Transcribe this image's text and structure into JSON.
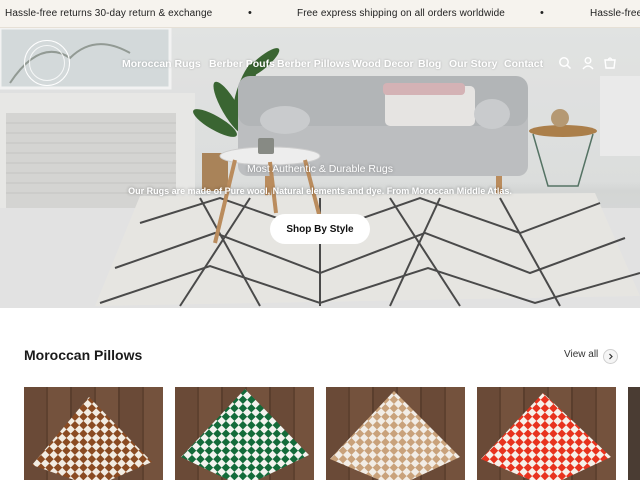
{
  "announcement": {
    "left_text": "Hassle-free returns 30-day return & exchange",
    "center_text": "Free express shipping on all orders worldwide",
    "right_text": "Hassle-free",
    "separator": "•"
  },
  "nav": {
    "items": [
      {
        "label": "Moroccan Rugs"
      },
      {
        "label": "Berber Poufs"
      },
      {
        "label": "Berber Pillows"
      },
      {
        "label": "Wood Decor"
      },
      {
        "label": "Blog"
      },
      {
        "label": "Our Story"
      },
      {
        "label": "Contact"
      }
    ],
    "icons": [
      "search-icon",
      "account-icon",
      "cart-icon"
    ]
  },
  "hero": {
    "subtitle": "Most Authentic & Durable Rugs",
    "description": "Our Rugs are made of Pure wool, Natural elements and dye. From Moroccan Middle Atlas.",
    "cta_label": "Shop By Style"
  },
  "section": {
    "title": "Moroccan Pillows",
    "view_all_label": "View all"
  },
  "products": [
    {
      "color": "#8a4b22",
      "pattern": "checkered-brown"
    },
    {
      "color": "#136b3a",
      "pattern": "checkered-green"
    },
    {
      "color": "#c9a27b",
      "pattern": "checkered-beige"
    },
    {
      "color": "#e8331e",
      "pattern": "checkered-red"
    }
  ],
  "colors": {
    "announcement_bg": "#f6f3ee",
    "text_dark": "#1a1a1a",
    "hero_text": "#ffffff"
  }
}
